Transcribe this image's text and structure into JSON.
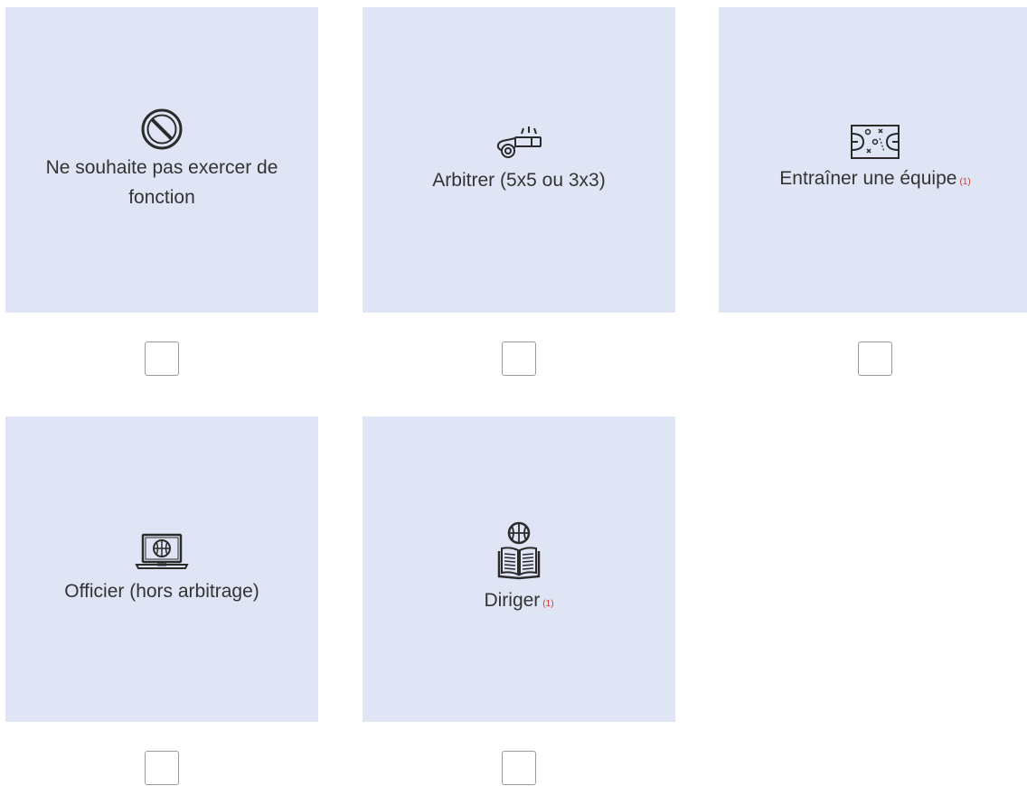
{
  "options": [
    {
      "label": "Ne souhaite pas exercer de fonction",
      "note": "",
      "icon": "prohibited-icon",
      "checked": false
    },
    {
      "label": "Arbitrer (5x5 ou 3x3)",
      "note": "",
      "icon": "whistle-icon",
      "checked": false
    },
    {
      "label": "Entraîner une équipe",
      "note": "(1)",
      "icon": "court-tactics-icon",
      "checked": false
    },
    {
      "label": "Officier (hors arbitrage)",
      "note": "",
      "icon": "laptop-basketball-icon",
      "checked": false
    },
    {
      "label": "Diriger",
      "note": "(1)",
      "icon": "basketball-book-icon",
      "checked": false
    }
  ],
  "colors": {
    "card_bg": "#e0e5f5",
    "note": "#d9342b",
    "text": "#333333"
  }
}
